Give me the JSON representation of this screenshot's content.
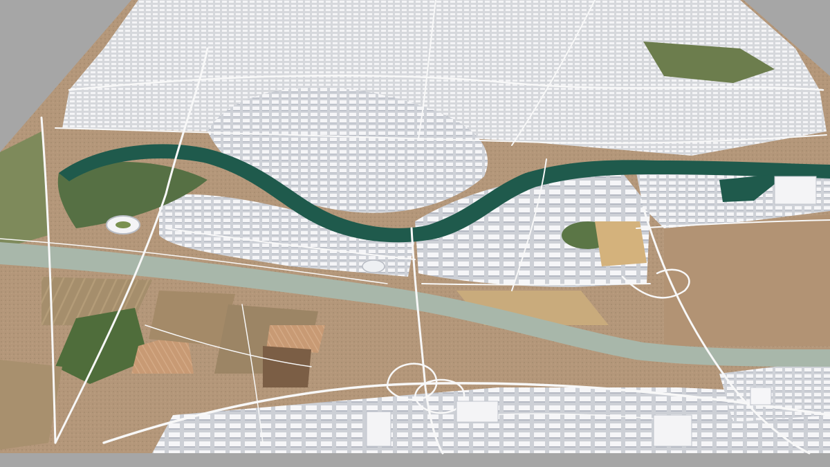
{
  "scene": {
    "kind": "3d-city-model-oblique-view",
    "background_color": "#a6a6a6",
    "palette": {
      "terrain_dry": "#b59a78",
      "terrain_field": "#9a8a6a",
      "terrain_plowed": "#c9a07a",
      "terrain_green": "#4f6b3a",
      "urban_base": "#d9dadc",
      "building": "#f2f2f4",
      "building_shadow": "#b8bcc4",
      "road": "#f7f7f7",
      "river_urban": "#1f5a4c",
      "canal_wide": "#a9b9ad",
      "park": "#5f7a45"
    },
    "features": [
      "historic-center",
      "river-meander",
      "wide-canal",
      "motorway-interchange",
      "stadium",
      "harbor-basin",
      "agricultural-fields",
      "industrial-park"
    ]
  }
}
